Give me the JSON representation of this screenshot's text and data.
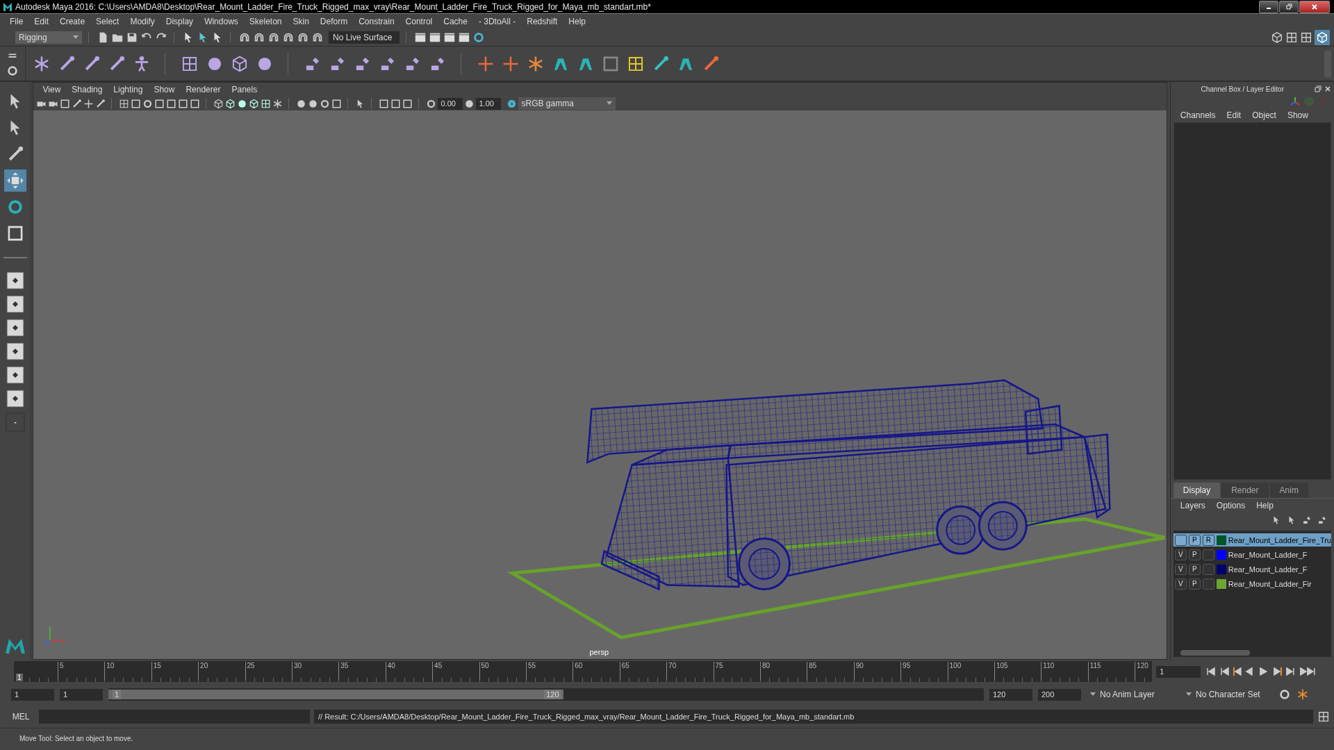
{
  "window": {
    "title": "Autodesk Maya 2016: C:\\Users\\AMDA8\\Desktop\\Rear_Mount_Ladder_Fire_Truck_Rigged_max_vray\\Rear_Mount_Ladder_Fire_Truck_Rigged_for_Maya_mb_standart.mb*"
  },
  "menu_bar": [
    "File",
    "Edit",
    "Create",
    "Select",
    "Modify",
    "Display",
    "Windows",
    "Skeleton",
    "Skin",
    "Deform",
    "Constrain",
    "Control",
    "Cache",
    "- 3DtoAll -",
    "Redshift",
    "Help"
  ],
  "status_line": {
    "menu_set": "Rigging",
    "live_surface": "No Live Surface"
  },
  "viewport": {
    "menu": [
      "View",
      "Shading",
      "Lighting",
      "Show",
      "Renderer",
      "Panels"
    ],
    "exposure": "0.00",
    "gamma": "1.00",
    "color_space": "sRGB gamma",
    "camera": "persp"
  },
  "channel_box": {
    "title": "Channel Box / Layer Editor",
    "menu": [
      "Channels",
      "Edit",
      "Object",
      "Show"
    ]
  },
  "layer_editor": {
    "tabs": [
      {
        "label": "Display",
        "selected": true
      },
      {
        "label": "Render",
        "selected": false
      },
      {
        "label": "Anim",
        "selected": false
      }
    ],
    "menu": [
      "Layers",
      "Options",
      "Help"
    ],
    "layers": [
      {
        "playback": "P",
        "reference": "R",
        "name": "Rear_Mount_Ladder_Fire_Tru",
        "color": "#00552b",
        "selected": true
      },
      {
        "visibility": "V",
        "playback": "P",
        "name": "Rear_Mount_Ladder_F",
        "color": "#0000ff",
        "selected": false
      },
      {
        "visibility": "V",
        "playback": "P",
        "name": "Rear_Mount_Ladder_F",
        "color": "#00006e",
        "selected": false
      },
      {
        "visibility": "V",
        "playback": "P",
        "name": "Rear_Mount_Ladder_Fir",
        "color": "#6ca632",
        "selected": false
      }
    ]
  },
  "time_slider": {
    "ticks": [
      "5",
      "10",
      "15",
      "20",
      "25",
      "30",
      "35",
      "40",
      "45",
      "50",
      "55",
      "60",
      "65",
      "70",
      "75",
      "80",
      "85",
      "90",
      "95",
      "100",
      "105",
      "110",
      "115",
      "120"
    ],
    "current_frame": "1",
    "level": 0,
    "frame_field": "1"
  },
  "range_slider": {
    "start": "1",
    "playback_start": "1",
    "range_start": "1",
    "range_end": "120",
    "level": 0.52,
    "playback_end": "120",
    "end": "200",
    "anim_layer": "No Anim Layer",
    "character_set": "No Character Set"
  },
  "command_line": {
    "language": "MEL",
    "result": "// Result: C:/Users/AMDA8/Desktop/Rear_Mount_Ladder_Fire_Truck_Rigged_max_vray/Rear_Mount_Ladder_Fire_Truck_Rigged_for_Maya_mb_standart.mb"
  },
  "help_line": "Move Tool: Select an object to move."
}
